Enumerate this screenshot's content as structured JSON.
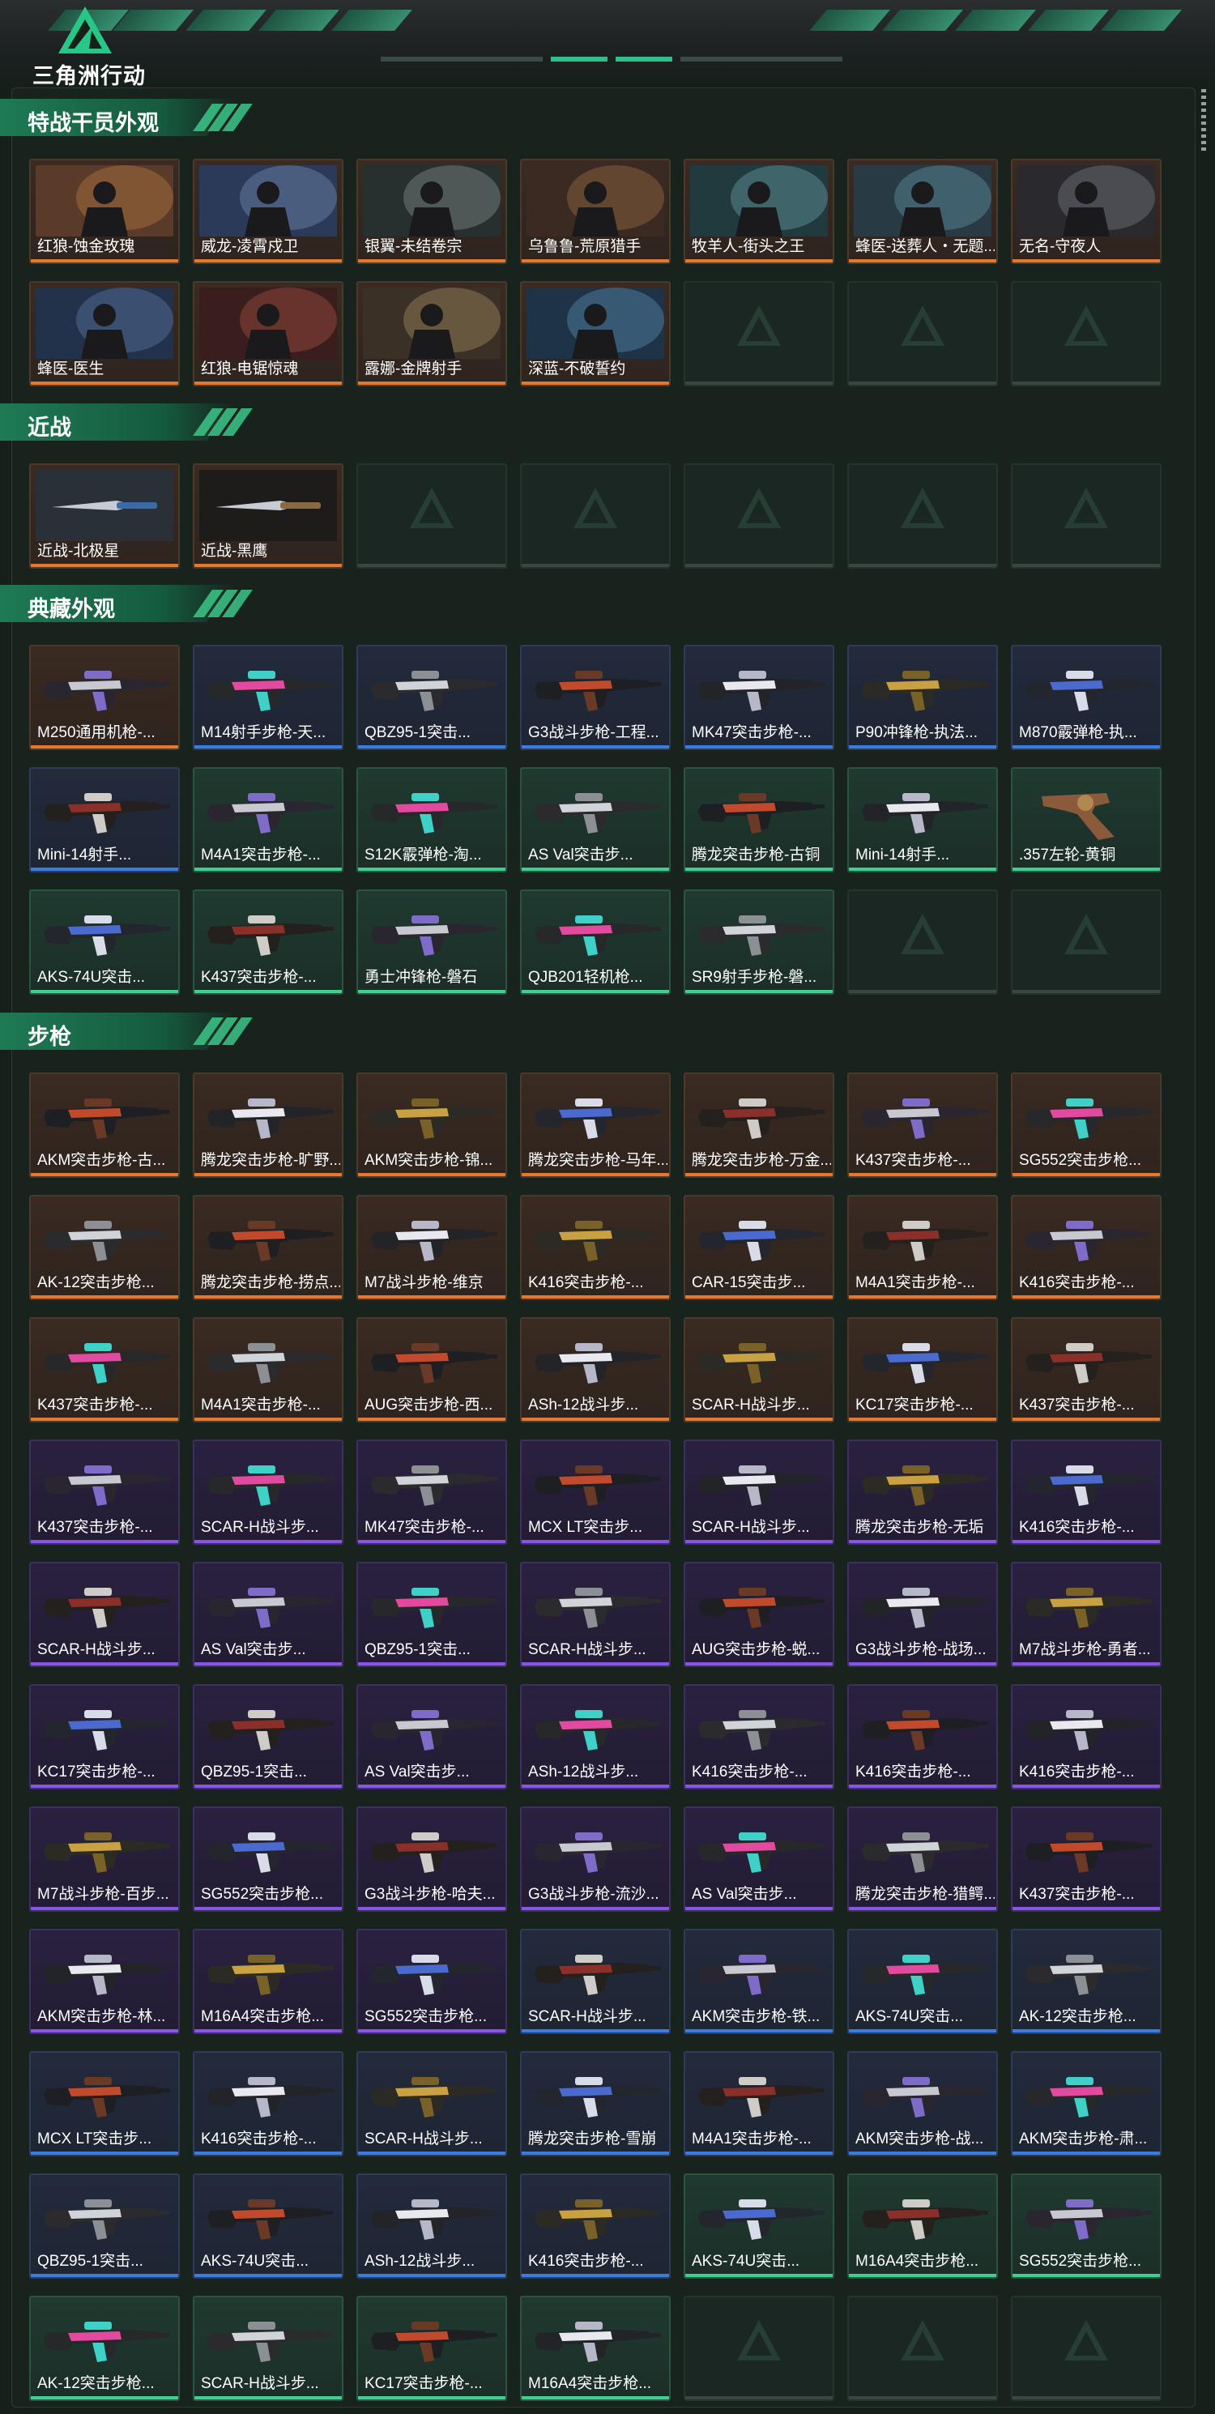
{
  "app": {
    "logo_text": "三角洲行动"
  },
  "colors": {
    "orange": "#e6782e",
    "blue": "#3a7de0",
    "green": "#3fd08f",
    "purple": "#8a55e6",
    "accent": "#2fbf8a"
  },
  "sections": [
    {
      "title": "特战干员外观",
      "items": [
        {
          "name": "红狼-蚀金玫瑰",
          "rarity": "orange",
          "art": "scene"
        },
        {
          "name": "威龙-凌霄戍卫",
          "rarity": "orange",
          "art": "scene"
        },
        {
          "name": "银翼-未结卷宗",
          "rarity": "orange",
          "art": "scene"
        },
        {
          "name": "乌鲁鲁-荒原猎手",
          "rarity": "orange",
          "art": "scene"
        },
        {
          "name": "牧羊人-街头之王",
          "rarity": "orange",
          "art": "scene"
        },
        {
          "name": "蜂医-送葬人・无题...",
          "rarity": "orange",
          "art": "scene"
        },
        {
          "name": "无名-守夜人",
          "rarity": "orange",
          "art": "scene"
        },
        {
          "name": "蜂医-医生",
          "rarity": "orange",
          "art": "scene"
        },
        {
          "name": "红狼-电锯惊魂",
          "rarity": "orange",
          "art": "scene"
        },
        {
          "name": "露娜-金牌射手",
          "rarity": "orange",
          "art": "scene"
        },
        {
          "name": "深蓝-不破誓约",
          "rarity": "orange",
          "art": "scene"
        },
        {
          "name": "",
          "rarity": "empty",
          "art": "empty"
        },
        {
          "name": "",
          "rarity": "empty",
          "art": "empty"
        },
        {
          "name": "",
          "rarity": "empty",
          "art": "empty"
        }
      ]
    },
    {
      "title": "近战",
      "items": [
        {
          "name": "近战-北极星",
          "rarity": "orange",
          "art": "knife"
        },
        {
          "name": "近战-黑鹰",
          "rarity": "orange",
          "art": "knife"
        },
        {
          "name": "",
          "rarity": "empty",
          "art": "empty"
        },
        {
          "name": "",
          "rarity": "empty",
          "art": "empty"
        },
        {
          "name": "",
          "rarity": "empty",
          "art": "empty"
        },
        {
          "name": "",
          "rarity": "empty",
          "art": "empty"
        },
        {
          "name": "",
          "rarity": "empty",
          "art": "empty"
        }
      ]
    },
    {
      "title": "典藏外观",
      "items": [
        {
          "name": "M250通用机枪-...",
          "rarity": "orange",
          "art": "gun"
        },
        {
          "name": "M14射手步枪-天...",
          "rarity": "blue",
          "art": "gun"
        },
        {
          "name": "QBZ95-1突击...",
          "rarity": "blue",
          "art": "gun"
        },
        {
          "name": "G3战斗步枪-工程...",
          "rarity": "blue",
          "art": "gun"
        },
        {
          "name": "MK47突击步枪-...",
          "rarity": "blue",
          "art": "gun"
        },
        {
          "name": "P90冲锋枪-执法...",
          "rarity": "blue",
          "art": "gun"
        },
        {
          "name": "M870霰弹枪-执...",
          "rarity": "blue",
          "art": "gun"
        },
        {
          "name": "Mini-14射手...",
          "rarity": "blue",
          "art": "gun"
        },
        {
          "name": "M4A1突击步枪-...",
          "rarity": "green",
          "art": "gun"
        },
        {
          "name": "S12K霰弹枪-淘...",
          "rarity": "green",
          "art": "gun"
        },
        {
          "name": "AS Val突击步...",
          "rarity": "green",
          "art": "gun"
        },
        {
          "name": "腾龙突击步枪-古铜",
          "rarity": "green",
          "art": "gun"
        },
        {
          "name": "Mini-14射手...",
          "rarity": "green",
          "art": "gun"
        },
        {
          "name": ".357左轮-黄铜",
          "rarity": "green",
          "art": "revolver"
        },
        {
          "name": "AKS-74U突击...",
          "rarity": "green",
          "art": "gun"
        },
        {
          "name": "K437突击步枪-...",
          "rarity": "green",
          "art": "gun"
        },
        {
          "name": "勇士冲锋枪-磐石",
          "rarity": "green",
          "art": "gun"
        },
        {
          "name": "QJB201轻机枪...",
          "rarity": "green",
          "art": "gun"
        },
        {
          "name": "SR9射手步枪-磐...",
          "rarity": "green",
          "art": "gun"
        },
        {
          "name": "",
          "rarity": "empty",
          "art": "empty"
        },
        {
          "name": "",
          "rarity": "empty",
          "art": "empty"
        }
      ]
    },
    {
      "title": "步枪",
      "items": [
        {
          "name": "AKM突击步枪-古...",
          "rarity": "orange",
          "art": "gun"
        },
        {
          "name": "腾龙突击步枪-旷野...",
          "rarity": "orange",
          "art": "gun"
        },
        {
          "name": "AKM突击步枪-锦...",
          "rarity": "orange",
          "art": "gun"
        },
        {
          "name": "腾龙突击步枪-马年...",
          "rarity": "orange",
          "art": "gun"
        },
        {
          "name": "腾龙突击步枪-万金...",
          "rarity": "orange",
          "art": "gun"
        },
        {
          "name": "K437突击步枪-...",
          "rarity": "orange",
          "art": "gun"
        },
        {
          "name": "SG552突击步枪...",
          "rarity": "orange",
          "art": "gun"
        },
        {
          "name": "AK-12突击步枪...",
          "rarity": "orange",
          "art": "gun"
        },
        {
          "name": "腾龙突击步枪-捞点...",
          "rarity": "orange",
          "art": "gun"
        },
        {
          "name": "M7战斗步枪-维京",
          "rarity": "orange",
          "art": "gun"
        },
        {
          "name": "K416突击步枪-...",
          "rarity": "orange",
          "art": "gun"
        },
        {
          "name": "CAR-15突击步...",
          "rarity": "orange",
          "art": "gun"
        },
        {
          "name": "M4A1突击步枪-...",
          "rarity": "orange",
          "art": "gun"
        },
        {
          "name": "K416突击步枪-...",
          "rarity": "orange",
          "art": "gun"
        },
        {
          "name": "K437突击步枪-...",
          "rarity": "orange",
          "art": "gun"
        },
        {
          "name": "M4A1突击步枪-...",
          "rarity": "orange",
          "art": "gun"
        },
        {
          "name": "AUG突击步枪-西...",
          "rarity": "orange",
          "art": "gun"
        },
        {
          "name": "ASh-12战斗步...",
          "rarity": "orange",
          "art": "gun"
        },
        {
          "name": "SCAR-H战斗步...",
          "rarity": "orange",
          "art": "gun"
        },
        {
          "name": "KC17突击步枪-...",
          "rarity": "orange",
          "art": "gun"
        },
        {
          "name": "K437突击步枪-...",
          "rarity": "orange",
          "art": "gun"
        },
        {
          "name": "K437突击步枪-...",
          "rarity": "purple",
          "art": "gun"
        },
        {
          "name": "SCAR-H战斗步...",
          "rarity": "purple",
          "art": "gun"
        },
        {
          "name": "MK47突击步枪-...",
          "rarity": "purple",
          "art": "gun"
        },
        {
          "name": "MCX LT突击步...",
          "rarity": "purple",
          "art": "gun"
        },
        {
          "name": "SCAR-H战斗步...",
          "rarity": "purple",
          "art": "gun"
        },
        {
          "name": "腾龙突击步枪-无垢",
          "rarity": "purple",
          "art": "gun"
        },
        {
          "name": "K416突击步枪-...",
          "rarity": "purple",
          "art": "gun"
        },
        {
          "name": "SCAR-H战斗步...",
          "rarity": "purple",
          "art": "gun"
        },
        {
          "name": "AS Val突击步...",
          "rarity": "purple",
          "art": "gun"
        },
        {
          "name": "QBZ95-1突击...",
          "rarity": "purple",
          "art": "gun"
        },
        {
          "name": "SCAR-H战斗步...",
          "rarity": "purple",
          "art": "gun"
        },
        {
          "name": "AUG突击步枪-蜕...",
          "rarity": "purple",
          "art": "gun"
        },
        {
          "name": "G3战斗步枪-战场...",
          "rarity": "purple",
          "art": "gun"
        },
        {
          "name": "M7战斗步枪-勇者...",
          "rarity": "purple",
          "art": "gun"
        },
        {
          "name": "KC17突击步枪-...",
          "rarity": "purple",
          "art": "gun"
        },
        {
          "name": "QBZ95-1突击...",
          "rarity": "purple",
          "art": "gun"
        },
        {
          "name": "AS Val突击步...",
          "rarity": "purple",
          "art": "gun"
        },
        {
          "name": "ASh-12战斗步...",
          "rarity": "purple",
          "art": "gun"
        },
        {
          "name": "K416突击步枪-...",
          "rarity": "purple",
          "art": "gun"
        },
        {
          "name": "K416突击步枪-...",
          "rarity": "purple",
          "art": "gun"
        },
        {
          "name": "K416突击步枪-...",
          "rarity": "purple",
          "art": "gun"
        },
        {
          "name": "M7战斗步枪-百步...",
          "rarity": "purple",
          "art": "gun"
        },
        {
          "name": "SG552突击步枪...",
          "rarity": "purple",
          "art": "gun"
        },
        {
          "name": "G3战斗步枪-哈夫...",
          "rarity": "purple",
          "art": "gun"
        },
        {
          "name": "G3战斗步枪-流沙...",
          "rarity": "purple",
          "art": "gun"
        },
        {
          "name": "AS Val突击步...",
          "rarity": "purple",
          "art": "gun"
        },
        {
          "name": "腾龙突击步枪-猎鳄...",
          "rarity": "purple",
          "art": "gun"
        },
        {
          "name": "K437突击步枪-...",
          "rarity": "purple",
          "art": "gun"
        },
        {
          "name": "AKM突击步枪-林...",
          "rarity": "purple",
          "art": "gun"
        },
        {
          "name": "M16A4突击步枪...",
          "rarity": "purple",
          "art": "gun"
        },
        {
          "name": "SG552突击步枪...",
          "rarity": "purple",
          "art": "gun"
        },
        {
          "name": "SCAR-H战斗步...",
          "rarity": "blue",
          "art": "gun"
        },
        {
          "name": "AKM突击步枪-铁...",
          "rarity": "blue",
          "art": "gun"
        },
        {
          "name": "AKS-74U突击...",
          "rarity": "blue",
          "art": "gun"
        },
        {
          "name": "AK-12突击步枪...",
          "rarity": "blue",
          "art": "gun"
        },
        {
          "name": "MCX LT突击步...",
          "rarity": "blue",
          "art": "gun"
        },
        {
          "name": "K416突击步枪-...",
          "rarity": "blue",
          "art": "gun"
        },
        {
          "name": "SCAR-H战斗步...",
          "rarity": "blue",
          "art": "gun"
        },
        {
          "name": "腾龙突击步枪-雪崩",
          "rarity": "blue",
          "art": "gun"
        },
        {
          "name": "M4A1突击步枪-...",
          "rarity": "blue",
          "art": "gun"
        },
        {
          "name": "AKM突击步枪-战...",
          "rarity": "blue",
          "art": "gun"
        },
        {
          "name": "AKM突击步枪-肃...",
          "rarity": "blue",
          "art": "gun"
        },
        {
          "name": "QBZ95-1突击...",
          "rarity": "blue",
          "art": "gun"
        },
        {
          "name": "AKS-74U突击...",
          "rarity": "blue",
          "art": "gun"
        },
        {
          "name": "ASh-12战斗步...",
          "rarity": "blue",
          "art": "gun"
        },
        {
          "name": "K416突击步枪-...",
          "rarity": "blue",
          "art": "gun"
        },
        {
          "name": "AKS-74U突击...",
          "rarity": "green",
          "art": "gun"
        },
        {
          "name": "M16A4突击步枪...",
          "rarity": "green",
          "art": "gun"
        },
        {
          "name": "SG552突击步枪...",
          "rarity": "green",
          "art": "gun"
        },
        {
          "name": "AK-12突击步枪...",
          "rarity": "green",
          "art": "gun"
        },
        {
          "name": "SCAR-H战斗步...",
          "rarity": "green",
          "art": "gun"
        },
        {
          "name": "KC17突击步枪-...",
          "rarity": "green",
          "art": "gun"
        },
        {
          "name": "M16A4突击步枪...",
          "rarity": "green",
          "art": "gun"
        },
        {
          "name": "",
          "rarity": "empty",
          "art": "empty"
        },
        {
          "name": "",
          "rarity": "empty",
          "art": "empty"
        },
        {
          "name": "",
          "rarity": "empty",
          "art": "empty"
        }
      ]
    }
  ]
}
